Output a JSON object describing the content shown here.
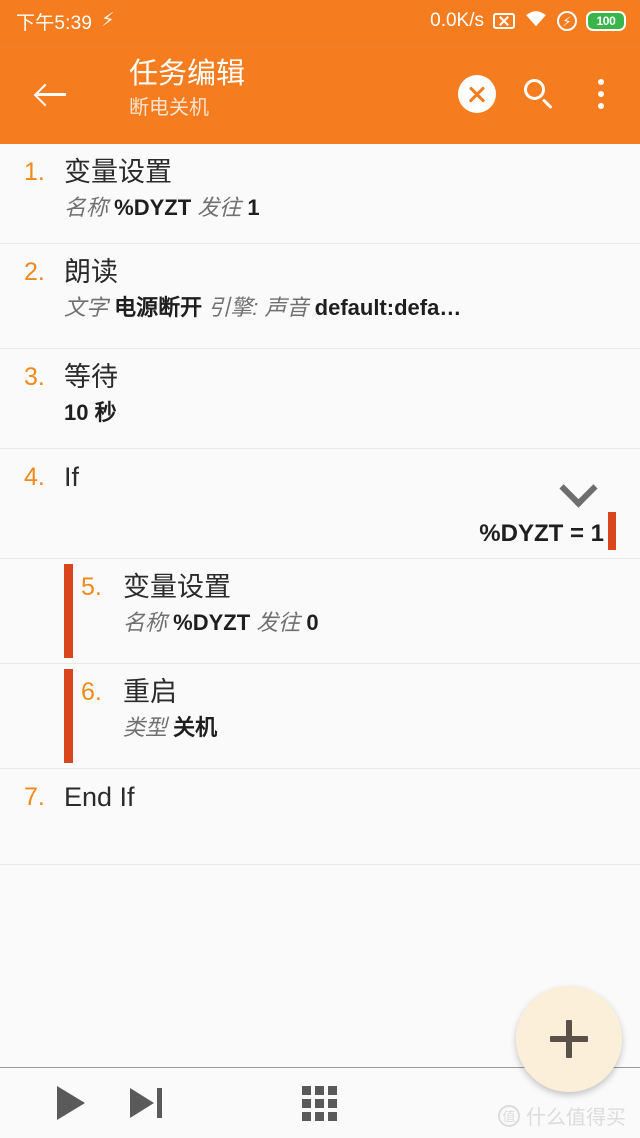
{
  "statusbar": {
    "clock": "下午5:39",
    "charging_icon": "⚡",
    "network_speed": "0.0K/s",
    "no_sim_icon": "no-sim-icon",
    "wifi_icon": "wifi-icon",
    "dnd_icon": "⚡",
    "battery_level": "100",
    "battery_color": "#39B54A",
    "background": "#F57C1F"
  },
  "appbar": {
    "title": "任务编辑",
    "subtitle": "断电关机",
    "back_icon": "back-arrow-icon",
    "close_icon": "close-circle-icon",
    "search_icon": "search-icon",
    "overflow_icon": "overflow-menu-icon",
    "background": "#F57C1F"
  },
  "accent": {
    "orange": "#F08A1C",
    "deep_orange": "#D9461E"
  },
  "actions": [
    {
      "num": "1.",
      "name": "变量设置",
      "desc": [
        {
          "t": "名称",
          "bold": false
        },
        {
          "t": "%DYZT",
          "bold": true
        },
        {
          "t": "发往",
          "bold": false
        },
        {
          "t": "1",
          "bold": true
        }
      ],
      "indented": false
    },
    {
      "num": "2.",
      "name": "朗读",
      "desc": [
        {
          "t": "文字",
          "bold": false
        },
        {
          "t": "电源断开",
          "bold": true
        },
        {
          "t": "引擎: 声音",
          "bold": false
        },
        {
          "t": "default:defa…",
          "bold": true
        }
      ],
      "indented": false
    },
    {
      "num": "3.",
      "name": "等待",
      "desc": [
        {
          "t": "10",
          "bold": true
        },
        {
          "t": "秒",
          "bold": true
        }
      ],
      "indented": false
    },
    {
      "num": "4.",
      "name": "If",
      "desc": [],
      "indented": false,
      "has_chevron": true,
      "chevron_icon": "chevron-down-icon",
      "condition": "%DYZT = 1"
    },
    {
      "num": "5.",
      "name": "变量设置",
      "desc": [
        {
          "t": "名称",
          "bold": false
        },
        {
          "t": "%DYZT",
          "bold": true
        },
        {
          "t": "发往",
          "bold": false
        },
        {
          "t": "0",
          "bold": true
        }
      ],
      "indented": true
    },
    {
      "num": "6.",
      "name": "重启",
      "desc": [
        {
          "t": "类型",
          "bold": false
        },
        {
          "t": "关机",
          "bold": true
        }
      ],
      "indented": true
    },
    {
      "num": "7.",
      "name": "End If",
      "desc": [],
      "indented": false
    }
  ],
  "bottombar": {
    "play_icon": "play-icon",
    "step_icon": "play-to-end-icon",
    "grid_icon": "grid-apps-icon"
  },
  "fab": {
    "icon": "plus-icon",
    "color": "#FCEFD9"
  },
  "watermark": {
    "badge": "值",
    "text": "什么值得买"
  }
}
